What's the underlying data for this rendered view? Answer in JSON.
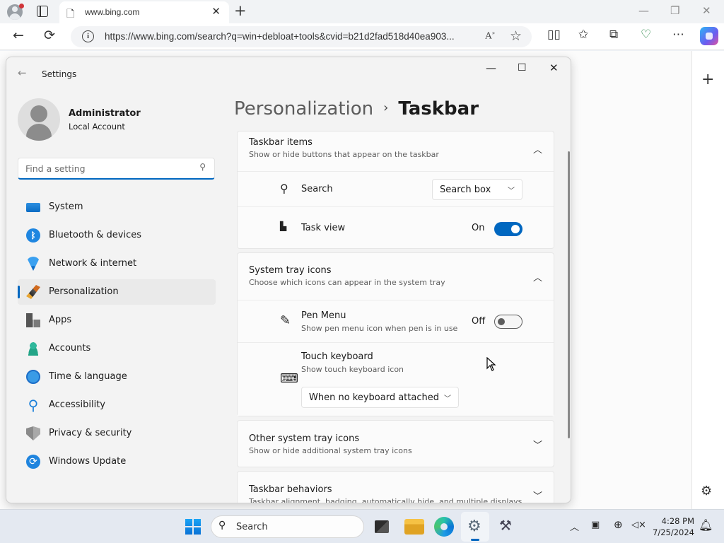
{
  "browser": {
    "tab_title": "www.bing.com",
    "url": "https://www.bing.com/search?q=win+debloat+tools&cvid=b21d2fad518d40ea903..."
  },
  "settings": {
    "app_title": "Settings",
    "user": {
      "name": "Administrator",
      "account_type": "Local Account"
    },
    "search_placeholder": "Find a setting",
    "nav": [
      {
        "label": "System",
        "icon": "system-icon",
        "selected": false
      },
      {
        "label": "Bluetooth & devices",
        "icon": "bluetooth-icon",
        "selected": false
      },
      {
        "label": "Network & internet",
        "icon": "wifi-icon",
        "selected": false
      },
      {
        "label": "Personalization",
        "icon": "brush-icon",
        "selected": true
      },
      {
        "label": "Apps",
        "icon": "apps-icon",
        "selected": false
      },
      {
        "label": "Accounts",
        "icon": "account-icon",
        "selected": false
      },
      {
        "label": "Time & language",
        "icon": "globe-clock-icon",
        "selected": false
      },
      {
        "label": "Accessibility",
        "icon": "accessibility-icon",
        "selected": false
      },
      {
        "label": "Privacy & security",
        "icon": "shield-icon",
        "selected": false
      },
      {
        "label": "Windows Update",
        "icon": "update-icon",
        "selected": false
      }
    ],
    "breadcrumb": {
      "parent": "Personalization",
      "current": "Taskbar"
    },
    "sections": {
      "taskbar_items": {
        "title": "Taskbar items",
        "subtitle": "Show or hide buttons that appear on the taskbar",
        "search": {
          "label": "Search",
          "value": "Search box"
        },
        "task_view": {
          "label": "Task view",
          "state": "On"
        }
      },
      "system_tray": {
        "title": "System tray icons",
        "subtitle": "Choose which icons can appear in the system tray",
        "pen_menu": {
          "label": "Pen Menu",
          "subtitle": "Show pen menu icon when pen is in use",
          "state": "Off"
        },
        "touch_keyboard": {
          "label": "Touch keyboard",
          "subtitle": "Show touch keyboard icon",
          "value": "When no keyboard attached"
        }
      },
      "other_tray": {
        "title": "Other system tray icons",
        "subtitle": "Show or hide additional system tray icons"
      },
      "behaviors": {
        "title": "Taskbar behaviors",
        "subtitle": "Taskbar alignment, badging, automatically hide, and multiple displays"
      }
    }
  },
  "taskbar": {
    "search_label": "Search",
    "time": "4:28 PM",
    "date": "7/25/2024"
  },
  "colors": {
    "accent": "#0067c0"
  }
}
